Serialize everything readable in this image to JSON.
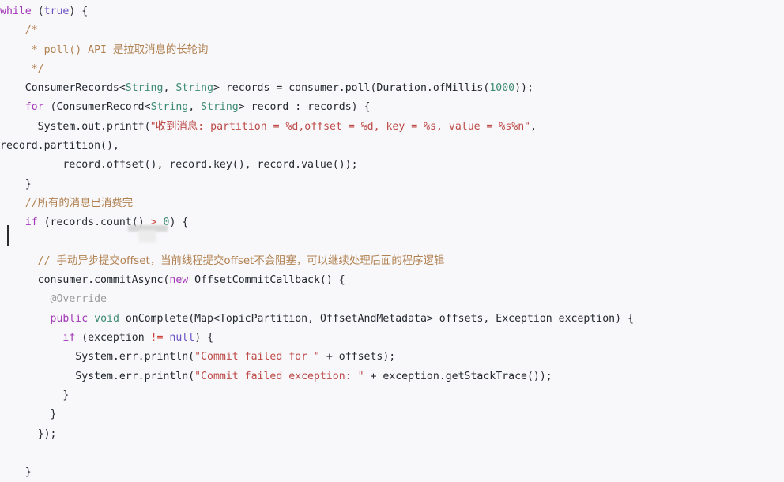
{
  "editor": {
    "language": "Java",
    "background_color": "#f8f7fa",
    "foreground_color": "#24292e",
    "caret_visible": true,
    "caret_line_index": 10,
    "redaction_present": true
  },
  "theme_colors": {
    "keyword": "#a238b8",
    "literal_keyword": "#6a52c4",
    "type_and_number": "#3d8b72",
    "string": "#bd4a47",
    "comment": "#b0804f",
    "annotation": "#9b9b9b",
    "operator": "#d0403a",
    "plain_text": "#24292e",
    "background": "#f8f7fa"
  },
  "code": {
    "lines": [
      "while (true) {",
      "    /*",
      "     * poll() API 是拉取消息的长轮询",
      "     */",
      "    ConsumerRecords<String, String> records = consumer.poll(Duration.ofMillis(1000));",
      "    for (ConsumerRecord<String, String> record : records) {",
      "      System.out.printf(\"收到消息: partition = %d,offset = %d, key = %s, value = %s%n\",",
      "record.partition(),",
      "          record.offset(), record.key(), record.value());",
      "    }",
      "    //所有的消息已消费完",
      "    if (records.count() > 0) {",
      "",
      "      // 手动异步提交offset，当前线程提交offset不会阻塞，可以继续处理后面的程序逻辑",
      "      consumer.commitAsync(new OffsetCommitCallback() {",
      "        @Override",
      "        public void onComplete(Map<TopicPartition, OffsetAndMetadata> offsets, Exception exception) {",
      "          if (exception != null) {",
      "            System.err.println(\"Commit failed for \" + offsets);",
      "            System.err.println(\"Commit failed exception: \" + exception.getStackTrace());",
      "          }",
      "        }",
      "      });",
      "",
      "    }"
    ],
    "tokens": {
      "keywords": [
        "while",
        "for",
        "if",
        "new",
        "public",
        "void"
      ],
      "literal_keywords": [
        "true",
        "null"
      ],
      "types": [
        "String",
        "ConsumerRecords",
        "ConsumerRecord",
        "Map",
        "TopicPartition",
        "OffsetAndMetadata",
        "Exception",
        "Duration",
        "OffsetCommitCallback"
      ],
      "numbers": [
        "1000",
        "0"
      ],
      "annotations": [
        "@Override"
      ],
      "strings": [
        "\"收到消息: partition = %d,offset = %d, key = %s, value = %s%n\"",
        "\"Commit failed for \"",
        "\"Commit failed exception: \""
      ],
      "comments": [
        "/*",
        "* poll() API 是拉取消息的长轮询",
        "*/",
        "//所有的消息已消费完",
        "// 手动异步提交offset，当前线程提交offset不会阻塞，可以继续处理后面的程序逻辑"
      ]
    }
  },
  "line_parts": {
    "l0_while": "while",
    "l0_open": " (",
    "l0_true": "true",
    "l0_close": ") {",
    "l1": "    /*",
    "l2_pre": "     * poll() API ",
    "l2_cjk": "是拉取消息的长轮询",
    "l3": "     */",
    "l4_a": "    ConsumerRecords<",
    "l4_s1": "String",
    "l4_b": ", ",
    "l4_s2": "String",
    "l4_c": "> records = consumer.poll(Duration.ofMillis(",
    "l4_num": "1000",
    "l4_d": "));",
    "l5_for": "for",
    "l5_a": " (ConsumerRecord<",
    "l5_s1": "String",
    "l5_b": ", ",
    "l5_s2": "String",
    "l5_c": "> record : records) {",
    "l6_a": "      System.out.printf(",
    "l6_strcjk": "\"收到消息",
    "l6_str": ": partition = %d,offset = %d, key = %s, value = %s%n\"",
    "l6_end": ",",
    "l7": "record.partition(),",
    "l8": "          record.offset(), record.key(), record.value());",
    "l9": "    }",
    "l10_slashes": "    //",
    "l10_cjk": "所有的消息已消费完",
    "l11_if": "if",
    "l11_a": " (records.count() ",
    "l11_gt": ">",
    "l11_b": " ",
    "l11_num": "0",
    "l11_c": ") {",
    "l13_slashes": "      // ",
    "l13_cjk": "手动异步提交offset，当前线程提交offset不会阻塞，可以继续处理后面的程序逻辑",
    "l14_a": "      consumer.commitAsync(",
    "l14_new": "new",
    "l14_b": " OffsetCommitCallback() {",
    "l15_anno": "        @Override",
    "l16_public": "public",
    "l16_sp": " ",
    "l16_void": "void",
    "l16_rest": " onComplete(Map<TopicPartition, OffsetAndMetadata> offsets, Exception exception) {",
    "l17_if": "if",
    "l17_a": " (exception ",
    "l17_neq": "!=",
    "l17_b": " ",
    "l17_null": "null",
    "l17_c": ") {",
    "l18_a": "            System.err.println(",
    "l18_str": "\"Commit failed for \"",
    "l18_b": " + offsets);",
    "l19_a": "            System.err.println(",
    "l19_str": "\"Commit failed exception: \"",
    "l19_b": " + exception.getStackTrace());",
    "l20": "          }",
    "l21": "        }",
    "l22": "      });",
    "l24": "    }"
  }
}
